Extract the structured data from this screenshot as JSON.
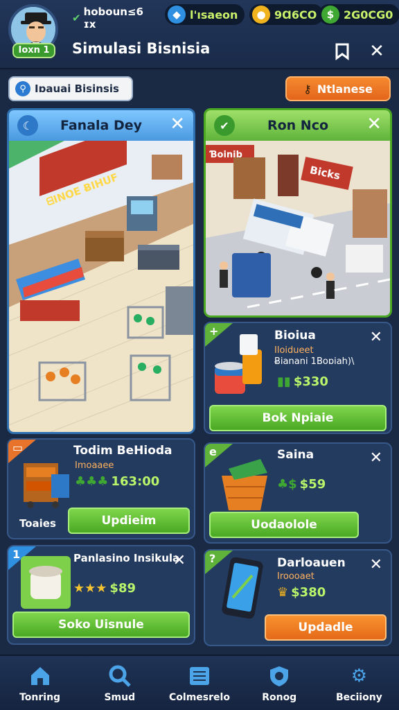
{
  "header": {
    "player_name": "hoboun≤6 ɪx",
    "level": "Ioxn 1",
    "title": "Simulasi Bisnisia",
    "resources": [
      {
        "icon": "gem-icon",
        "value": "l'ısaeon",
        "color": "#2f8fe0"
      },
      {
        "icon": "coin-icon",
        "value": "9Ɑ6CO",
        "color": "#f0b21d"
      },
      {
        "icon": "cash-icon",
        "value": "2G0CG0",
        "color": "#3fa832"
      }
    ]
  },
  "search": {
    "placeholder": "Iɒauai Bisinsis"
  },
  "action_button": {
    "label": "Ntlanese"
  },
  "panels": {
    "left": {
      "title": "Fanala Dey",
      "sign": "ᗺINOE ɃIHUF"
    },
    "right": {
      "title": "Ron Nco",
      "sign_left": "Ɓoinib",
      "sign_right": "Bicks"
    }
  },
  "cards": [
    {
      "corner": "+",
      "title": "Bioiua",
      "sub1": "Iloidueet",
      "sub2": "Ƀianani 1Boɒiah)\\",
      "price": "$330",
      "button": "Bok Npiaie"
    },
    {
      "corner": "",
      "title": "Todim BeHioda",
      "sub1": "Imoaaee",
      "price": "163:00",
      "side_label": "Toaies",
      "button": "Updieim"
    },
    {
      "corner": "e",
      "title": "Saina",
      "price": "$59",
      "button": "Uodaolole"
    },
    {
      "corner": "1",
      "title": "Panlasino Insikula",
      "price": "$89",
      "button": "Soko Uisnule"
    },
    {
      "corner": "?",
      "title": "Darloauen",
      "sub1": "Iroooaet",
      "price": "$380",
      "button": "Updadle"
    }
  ],
  "nav": [
    {
      "icon": "home-icon",
      "label": "Tonring"
    },
    {
      "icon": "search-icon",
      "label": "Smud"
    },
    {
      "icon": "ledger-icon",
      "label": "Colmesrelo"
    },
    {
      "icon": "shield-icon",
      "label": "Ronog"
    },
    {
      "icon": "gear-icon",
      "label": "Beciiony"
    }
  ]
}
